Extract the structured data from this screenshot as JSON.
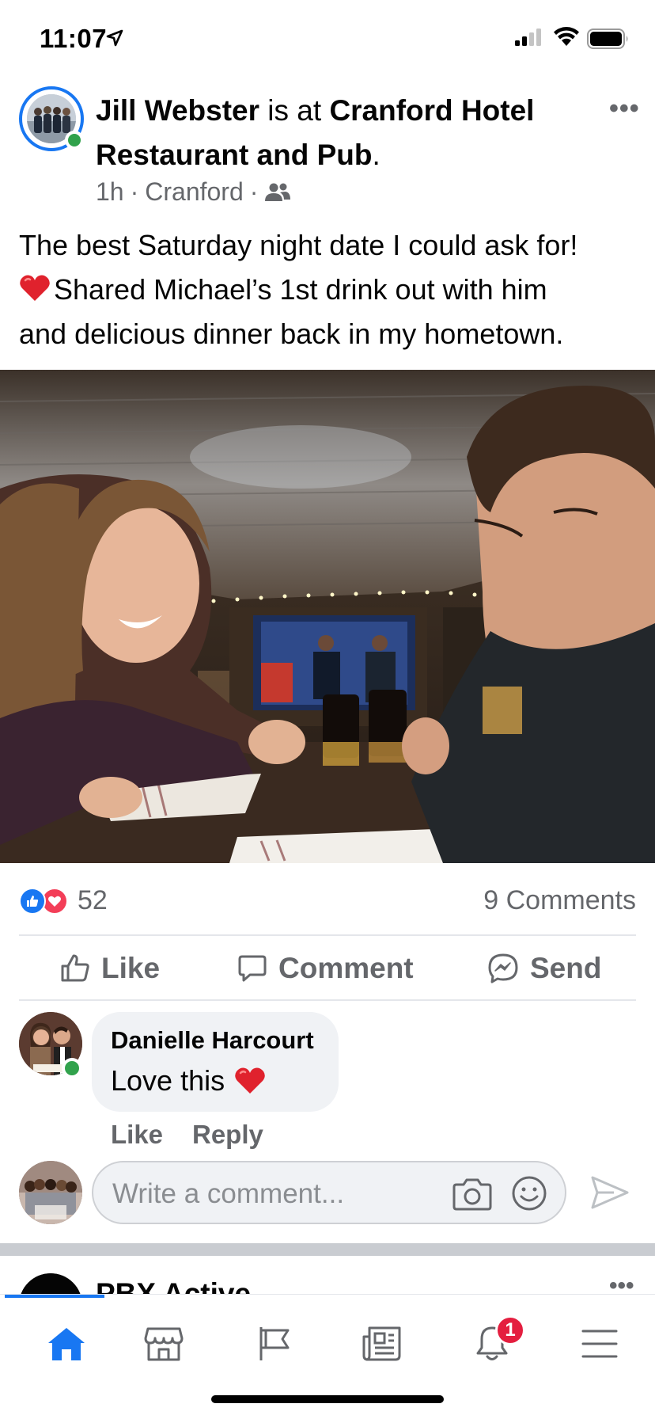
{
  "status_bar": {
    "time": "11:07"
  },
  "post": {
    "author": "Jill Webster",
    "connector": "is at",
    "place": "Cranford Hotel Restaurant and Pub",
    "period": ".",
    "time_ago": "1h",
    "location": "Cranford",
    "audience_icon": "friends-icon",
    "text_line1": "The best Saturday night date I could ask for!",
    "text_line2": "Shared Michael’s 1st drink out with him",
    "text_line3": "and delicious dinner back in my hometown.",
    "reaction_count": "52",
    "comments_label": "9 Comments"
  },
  "actions": {
    "like": "Like",
    "comment": "Comment",
    "send": "Send"
  },
  "comment": {
    "author": "Danielle Harcourt",
    "text": "Love this",
    "like_label": "Like",
    "reply_label": "Reply"
  },
  "composer": {
    "placeholder": "Write a comment..."
  },
  "next_post": {
    "name": "PBX Active"
  },
  "bottom_nav": {
    "items": [
      "home-icon",
      "marketplace-icon",
      "pages-flag-icon",
      "news-icon",
      "notifications-icon",
      "menu-icon"
    ],
    "notification_count": "1"
  },
  "colors": {
    "accent": "#1877f2",
    "love": "#f33e58",
    "online": "#31a24c",
    "secondary_text": "#65676b"
  }
}
